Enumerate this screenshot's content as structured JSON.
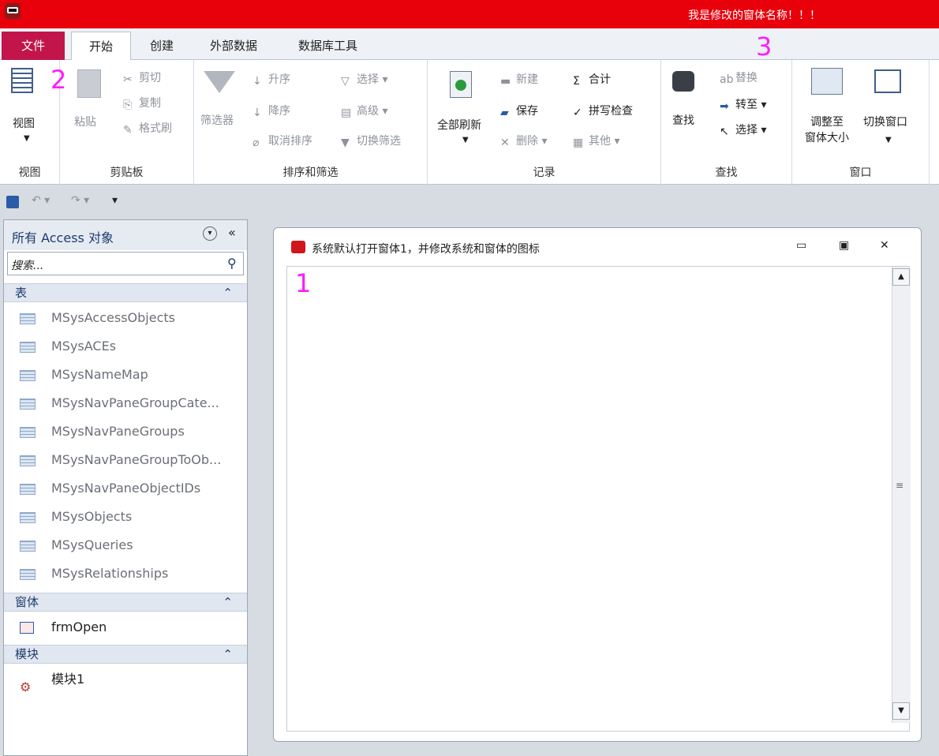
{
  "window": {
    "title": "我是修改的窗体名称！！！"
  },
  "tabs": [
    "文件",
    "开始",
    "创建",
    "外部数据",
    "数据库工具"
  ],
  "ribbon": {
    "view": {
      "button": "视图",
      "group": "视图"
    },
    "clipboard": {
      "paste": "粘贴",
      "cut": "剪切",
      "copy": "复制",
      "format_painter": "格式刷",
      "group": "剪贴板"
    },
    "sort_filter": {
      "filter": "筛选器",
      "ascending": "升序",
      "descending": "降序",
      "remove_sort": "取消排序",
      "selection": "选择",
      "advanced": "高级",
      "toggle_filter": "切换筛选",
      "group": "排序和筛选"
    },
    "records": {
      "refresh_all": "全部刷新",
      "new": "新建",
      "save": "保存",
      "delete": "删除",
      "totals": "合计",
      "spelling": "拼写检查",
      "more": "其他",
      "group": "记录"
    },
    "find": {
      "find": "查找",
      "replace": "替换",
      "goto": "转至",
      "select": "选择",
      "group": "查找"
    },
    "window": {
      "size_to_fit": "调整至\n窗体大小",
      "size_line1": "调整至",
      "size_line2": "窗体大小",
      "switch_windows": "切换窗口",
      "group": "窗口"
    }
  },
  "nav": {
    "title": "所有 Access 对象",
    "search_placeholder": "搜索...",
    "sections": [
      {
        "label": "表",
        "items": [
          "MSysAccessObjects",
          "MSysACEs",
          "MSysNameMap",
          "MSysNavPaneGroupCate...",
          "MSysNavPaneGroups",
          "MSysNavPaneGroupToOb...",
          "MSysNavPaneObjectIDs",
          "MSysObjects",
          "MSysQueries",
          "MSysRelationships"
        ]
      },
      {
        "label": "窗体",
        "items": [
          "frmOpen"
        ]
      },
      {
        "label": "模块",
        "items": [
          "模块1"
        ]
      }
    ]
  },
  "document": {
    "title": "系统默认打开窗体1，并修改系统和窗体的图标"
  },
  "annotations": [
    "1",
    "2",
    "3"
  ],
  "colors": {
    "titlebar": "#e8000b",
    "file_tab": "#c2154b",
    "annotation": "#ff1aff"
  }
}
